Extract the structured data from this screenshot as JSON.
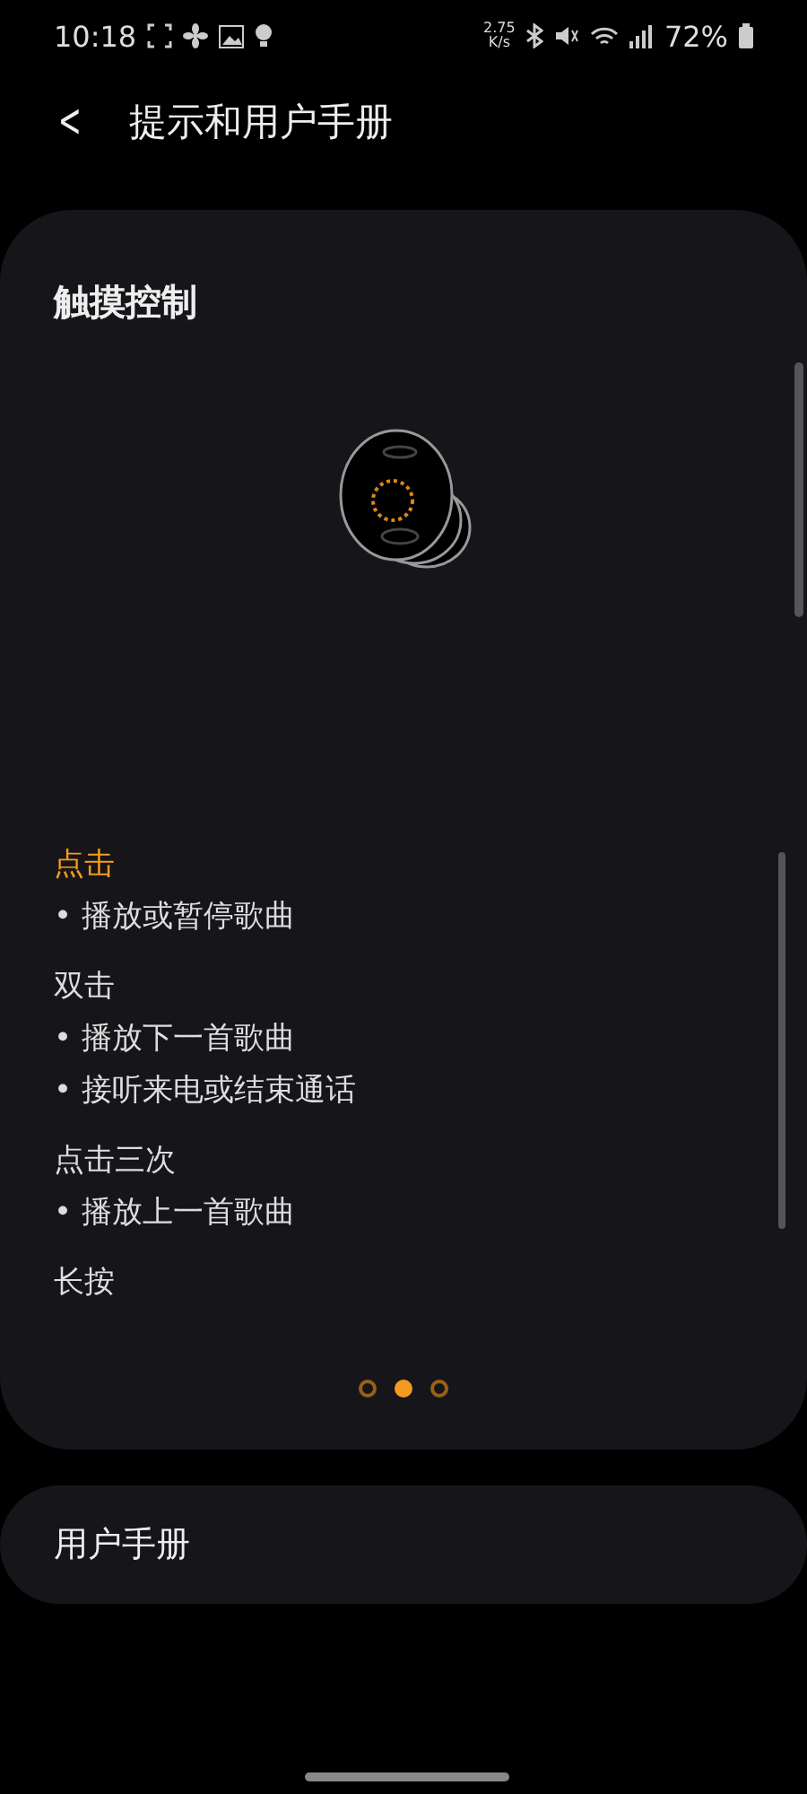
{
  "status_bar": {
    "time": "10:18",
    "speed": "2.75 K/s",
    "battery": "72%"
  },
  "header": {
    "back": "<",
    "title": "提示和用户手册"
  },
  "card": {
    "title": "触摸控制",
    "gestures": [
      {
        "name": "点击",
        "highlighted": true,
        "actions": [
          "• 播放或暂停歌曲"
        ]
      },
      {
        "name": "双击",
        "highlighted": false,
        "actions": [
          "• 播放下一首歌曲",
          "• 接听来电或结束通话"
        ]
      },
      {
        "name": "点击三次",
        "highlighted": false,
        "actions": [
          "• 播放上一首歌曲"
        ]
      },
      {
        "name": "长按",
        "highlighted": false
      }
    ],
    "pages": [
      {
        "selected": false
      },
      {
        "selected": true
      },
      {
        "selected": false
      }
    ]
  },
  "manual": {
    "label": "用户手册"
  }
}
